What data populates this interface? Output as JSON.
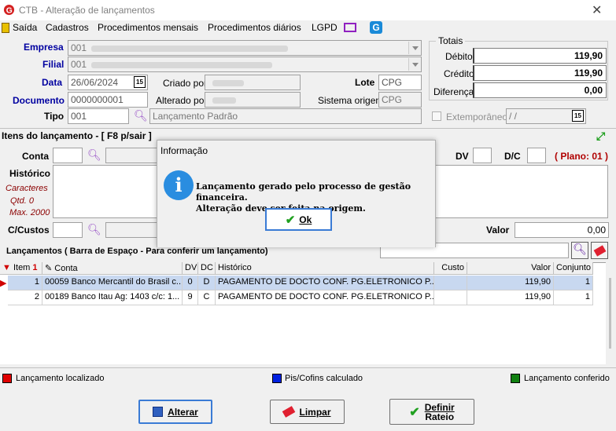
{
  "window": {
    "title": "CTB - Alteração de lançamentos",
    "close": "✕"
  },
  "menu": [
    "Saída",
    "Cadastros",
    "Procedimentos mensais",
    "Procedimentos diários",
    "LGPD"
  ],
  "header": {
    "empresa_label": "Empresa",
    "empresa_value": "001",
    "filial_label": "Filial",
    "filial_value": "001",
    "data_label": "Data",
    "data_value": "26/06/2024",
    "criado_label": "Criado por",
    "alterado_label": "Alterado por",
    "lote_label": "Lote",
    "lote_value": "CPG",
    "sistema_label": "Sistema origem",
    "sistema_value": "CPG",
    "documento_label": "Documento",
    "documento_value": "0000000001",
    "tipo_label": "Tipo",
    "tipo_value": "001",
    "tipo_desc": "Lançamento Padrão",
    "cal_icon": "15"
  },
  "totais": {
    "title": "Totais",
    "debito_label": "Débito",
    "debito_value": "119,90",
    "credito_label": "Crédito",
    "credito_value": "119,90",
    "diferenca_label": "Diferença",
    "diferenca_value": "0,00",
    "extemporaneo_label": "Extemporâneo",
    "extemporaneo_value": " /  /"
  },
  "itens": {
    "title": "Itens do lançamento - [ F8 p/sair ]",
    "conta_label": "Conta",
    "dv_label": "DV",
    "dc_label": "D/C",
    "plano": "( Plano: 01 )",
    "historico_label": "Histórico",
    "caracteres": "Caracteres",
    "qtd": "Qtd. 0",
    "max": "Max. 2000",
    "ccustos_label": "C/Custos",
    "valor_label": "Valor",
    "valor_value": "0,00"
  },
  "lancamentos": {
    "title": "Lançamentos ( Barra de Espaço - Para conferir um lançamento)",
    "columns": [
      "Item",
      "Conta",
      "DV",
      "DC",
      "Histórico",
      "Custo",
      "Valor",
      "Conjunto"
    ],
    "rows": [
      {
        "item": "1",
        "conta": "00059 Banco Mercantil do Brasil c...",
        "dv": "0",
        "dc": "D",
        "historico": "PAGAMENTO DE DOCTO CONF. PG.ELETRONICO P...",
        "custo": "",
        "valor": "119,90",
        "conjunto": "1"
      },
      {
        "item": "2",
        "conta": "00189 Banco Itau Ag: 1403 c/c: 1...",
        "dv": "9",
        "dc": "C",
        "historico": "PAGAMENTO DE DOCTO CONF. PG.ELETRONICO P...",
        "custo": "",
        "valor": "119,90",
        "conjunto": "1"
      }
    ]
  },
  "legend": {
    "localizado": "Lançamento localizado",
    "localizado_color": "#e00000",
    "piscofins": "Pis/Cofins calculado",
    "piscofins_color": "#0020e0",
    "conferido": "Lançamento conferido",
    "conferido_color": "#108010"
  },
  "buttons": {
    "alterar": "Alterar",
    "limpar": "Limpar",
    "definir": "Definir",
    "rateio": "Rateio"
  },
  "dialog": {
    "title": "Informação",
    "icon": "i",
    "line1": "Lançamento gerado pelo processo de gestão financeira.",
    "line2": "Alteração deve ser feita na origem.",
    "ok": "Ok"
  }
}
